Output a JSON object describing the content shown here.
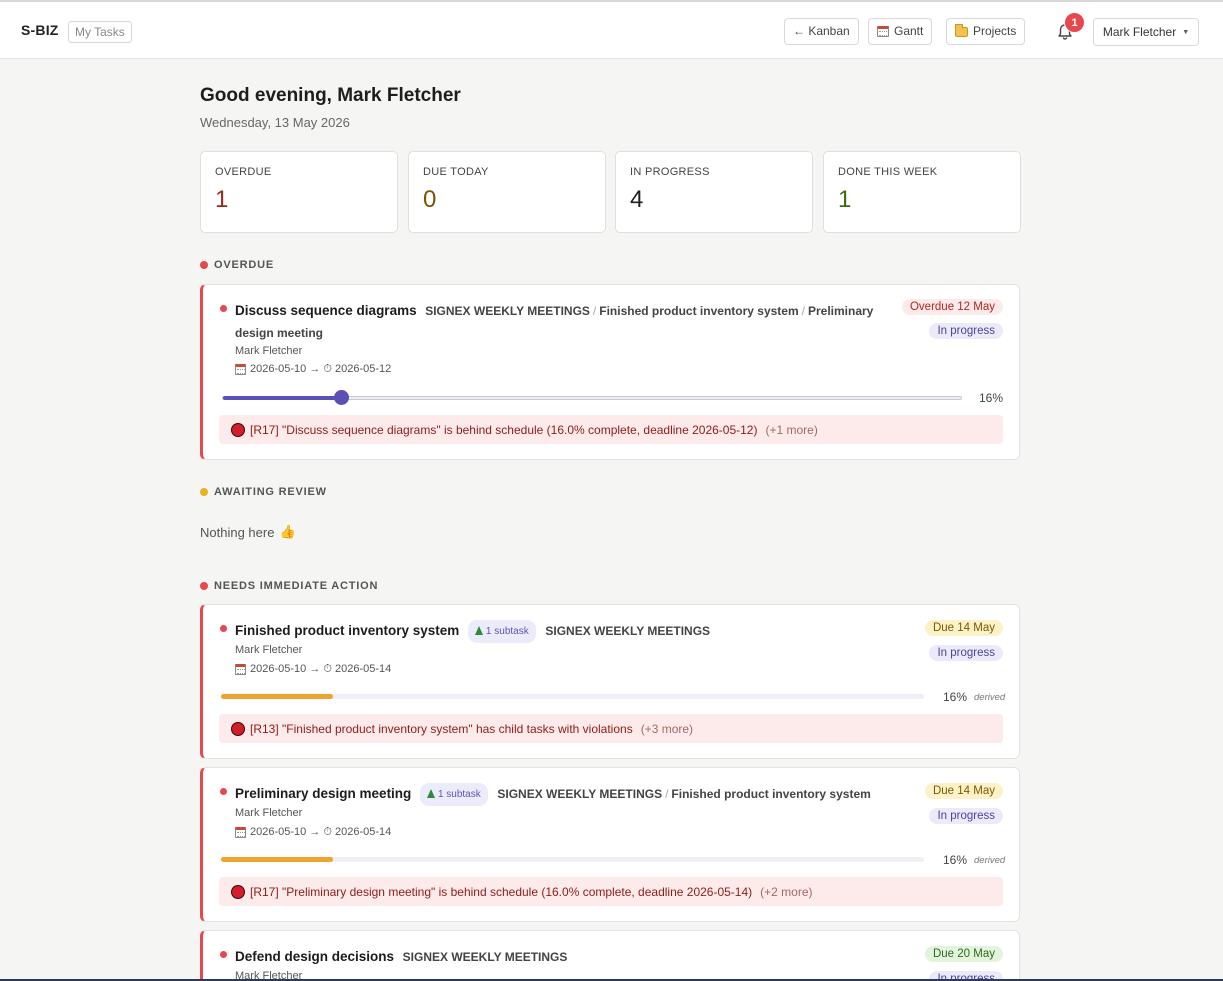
{
  "topbar": {
    "brand": "S-BIZ",
    "my_tasks": "My Tasks",
    "kanban": "← Kanban",
    "gantt": "Gantt",
    "projects": "Projects",
    "notifications": "1",
    "user": "Mark Fletcher"
  },
  "header": {
    "greeting": "Good evening, Mark Fletcher",
    "date": "Wednesday, 13 May 2026"
  },
  "stats": [
    {
      "label": "OVERDUE",
      "value": "1",
      "color": "#9a2a1e"
    },
    {
      "label": "DUE TODAY",
      "value": "0",
      "color": "#7a5208"
    },
    {
      "label": "IN PROGRESS",
      "value": "4",
      "color": "#1f1f1f"
    },
    {
      "label": "DONE THIS WEEK",
      "value": "1",
      "color": "#3d6b1a"
    }
  ],
  "sections": {
    "overdue": "OVERDUE",
    "awaiting_review": "AWAITING REVIEW",
    "nothing_here": "Nothing here",
    "needs_action": "NEEDS IMMEDIATE ACTION"
  },
  "overdue_cards": [
    {
      "title": "Discuss sequence diagrams",
      "crumbs": [
        "SIGNEX WEEKLY MEETINGS",
        "Finished product inventory system",
        "Preliminary design meeting"
      ],
      "owner": "Mark Fletcher",
      "dates": "2026-05-10 → ⏱ 2026-05-12",
      "due_pill": "Overdue 12 May",
      "status": "In progress",
      "progress": 16,
      "progress_label": "16%",
      "alert": "[R17] \"Discuss sequence diagrams\" is behind schedule (16.0% complete, deadline 2026-05-12)",
      "alert_more": "(+1 more)"
    }
  ],
  "action_cards": [
    {
      "title": "Finished product inventory system",
      "subtask": "1 subtask",
      "crumbs": [
        "SIGNEX WEEKLY MEETINGS"
      ],
      "owner": "Mark Fletcher",
      "dates": "2026-05-10 → ⏱ 2026-05-14",
      "due_pill": "Due 14 May",
      "status": "In progress",
      "progress": 16,
      "progress_label": "16%",
      "derived": "derived",
      "alert": "[R13] \"Finished product inventory system\" has child tasks with violations",
      "alert_more": "(+3 more)"
    },
    {
      "title": "Preliminary design meeting",
      "subtask": "1 subtask",
      "crumbs": [
        "SIGNEX WEEKLY MEETINGS",
        "Finished product inventory system"
      ],
      "owner": "Mark Fletcher",
      "dates": "2026-05-10 → ⏱ 2026-05-14",
      "due_pill": "Due 14 May",
      "status": "In progress",
      "progress": 16,
      "progress_label": "16%",
      "derived": "derived",
      "alert": "[R17] \"Preliminary design meeting\" is behind schedule (16.0% complete, deadline 2026-05-14)",
      "alert_more": "(+2 more)"
    },
    {
      "title": "Defend design decisions",
      "crumbs": [
        "SIGNEX WEEKLY MEETINGS"
      ],
      "owner": "Mark Fletcher",
      "due_pill": "Due 20 May",
      "status": "In progress"
    }
  ]
}
